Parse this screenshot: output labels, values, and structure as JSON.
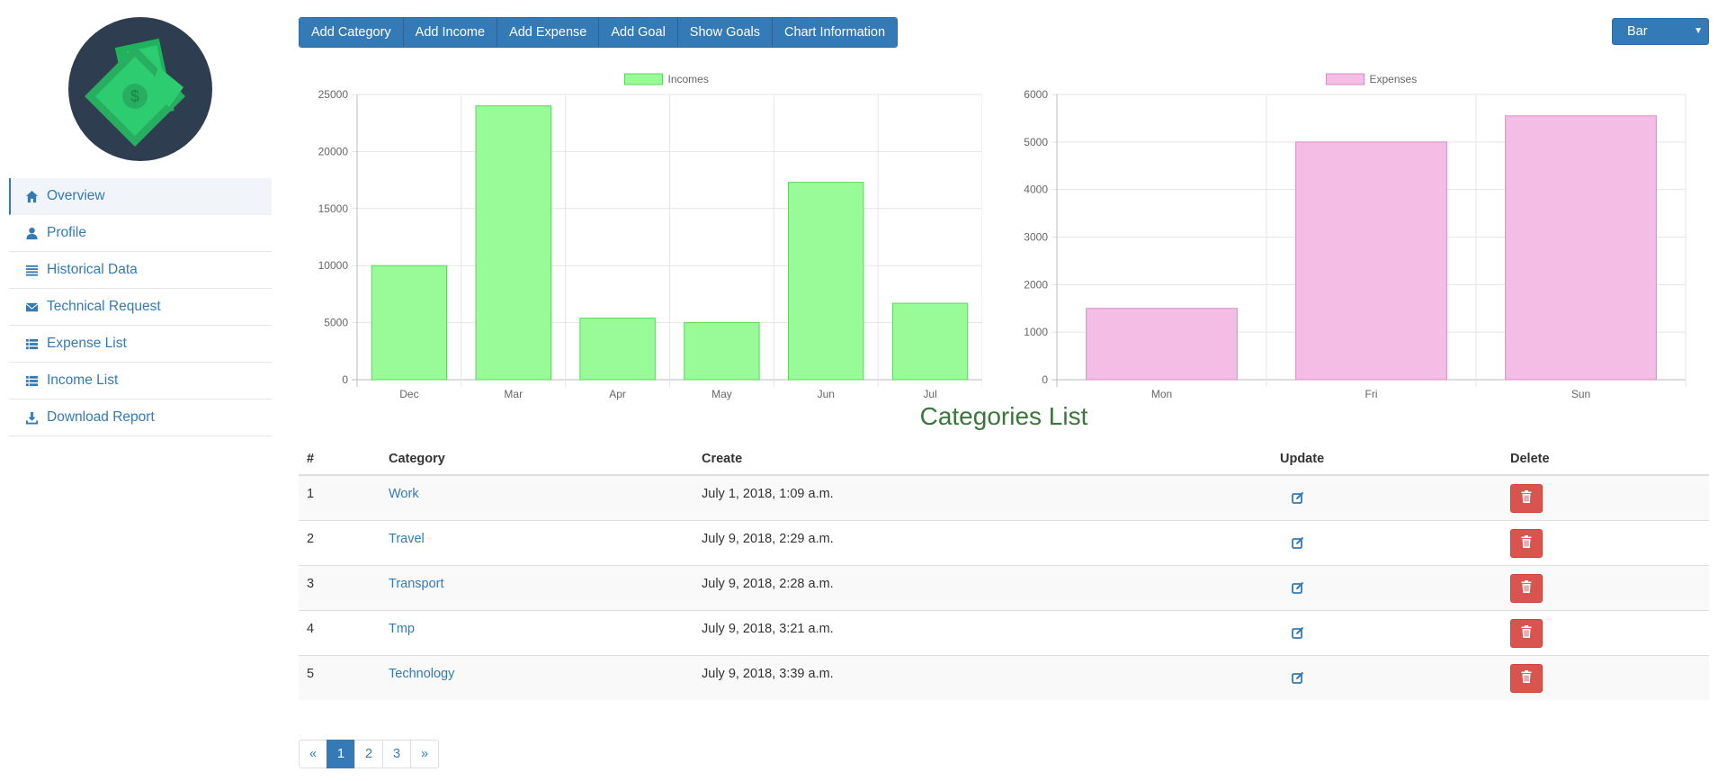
{
  "sidebar": {
    "items": [
      {
        "label": "Overview",
        "icon": "home-icon",
        "active": true
      },
      {
        "label": "Profile",
        "icon": "user-icon"
      },
      {
        "label": "Historical Data",
        "icon": "list-icon"
      },
      {
        "label": "Technical Request",
        "icon": "envelope-icon"
      },
      {
        "label": "Expense List",
        "icon": "th-list-icon"
      },
      {
        "label": "Income List",
        "icon": "th-list-icon"
      },
      {
        "label": "Download Report",
        "icon": "download-icon"
      }
    ]
  },
  "toolbar": {
    "buttons": [
      "Add Category",
      "Add Income",
      "Add Expense",
      "Add Goal",
      "Show Goals",
      "Chart Information"
    ]
  },
  "chart_type_select": {
    "value": "Bar"
  },
  "colors": {
    "primary": "#337ab7",
    "income_fill": "#98fb98",
    "income_border": "#5cd65c",
    "expense_fill": "#f3bde6",
    "expense_border": "#d98cc6",
    "danger": "#d9534f",
    "title_green": "#3c763d"
  },
  "chart_data": [
    {
      "type": "bar",
      "categories": [
        "Dec",
        "Mar",
        "Apr",
        "May",
        "Jun",
        "Jul"
      ],
      "series": [
        {
          "name": "Incomes",
          "values": [
            10000,
            24000,
            5400,
            5000,
            17300,
            6700
          ]
        }
      ],
      "ylim": [
        0,
        25000
      ],
      "yticks": [
        0,
        5000,
        10000,
        15000,
        20000,
        25000
      ],
      "legend": "top-center",
      "grid": true
    },
    {
      "type": "bar",
      "categories": [
        "Mon",
        "Fri",
        "Sun"
      ],
      "series": [
        {
          "name": "Expenses",
          "values": [
            1500,
            5000,
            5550
          ]
        }
      ],
      "ylim": [
        0,
        6000
      ],
      "yticks": [
        0,
        1000,
        2000,
        3000,
        4000,
        5000,
        6000
      ],
      "legend": "top-center",
      "grid": true
    }
  ],
  "categories_list": {
    "title": "Categories List",
    "headers": [
      "#",
      "Category",
      "Create",
      "Update",
      "Delete"
    ],
    "rows": [
      {
        "num": "1",
        "category": "Work",
        "created": "July 1, 2018, 1:09 a.m."
      },
      {
        "num": "2",
        "category": "Travel",
        "created": "July 9, 2018, 2:29 a.m."
      },
      {
        "num": "3",
        "category": "Transport",
        "created": "July 9, 2018, 2:28 a.m."
      },
      {
        "num": "4",
        "category": "Tmp",
        "created": "July 9, 2018, 3:21 a.m."
      },
      {
        "num": "5",
        "category": "Technology",
        "created": "July 9, 2018, 3:39 a.m."
      }
    ]
  },
  "pagination": {
    "prev": "«",
    "pages": [
      "1",
      "2",
      "3"
    ],
    "current": "1",
    "next": "»"
  }
}
